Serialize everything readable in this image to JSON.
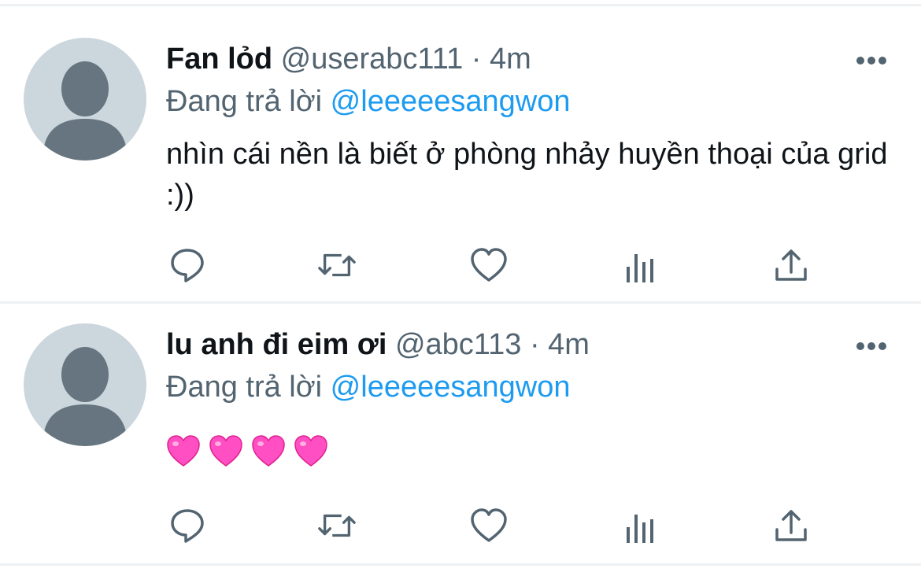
{
  "tweets": [
    {
      "name": "Fan lỏd",
      "handle": "@userabc111",
      "separator": "·",
      "time": "4m",
      "reply_prefix": "Đang trả lời",
      "reply_to": "@leeeeesangwon",
      "content": "nhìn cái nền là biết ở phòng nhảy huyền thoại của grid :))"
    },
    {
      "name": "lu anh đi eim ơi",
      "handle": "@abc113",
      "separator": "·",
      "time": "4m",
      "reply_prefix": "Đang trả lời",
      "reply_to": "@leeeeesangwon",
      "content_emoji": [
        "heart-emoji",
        "heart-emoji",
        "heart-emoji",
        "heart-emoji"
      ]
    }
  ],
  "icons": {
    "more": "more-icon",
    "reply": "reply-icon",
    "retweet": "retweet-icon",
    "like": "like-icon",
    "analytics": "analytics-icon",
    "share": "share-icon"
  },
  "colors": {
    "text": "#0f1419",
    "secondary": "#536471",
    "link": "#1d9bf0",
    "avatar_bg": "#ccd6dd",
    "avatar_fg": "#66757f",
    "divider": "#eef1f3",
    "heart_emoji": "#ff4fc3"
  }
}
